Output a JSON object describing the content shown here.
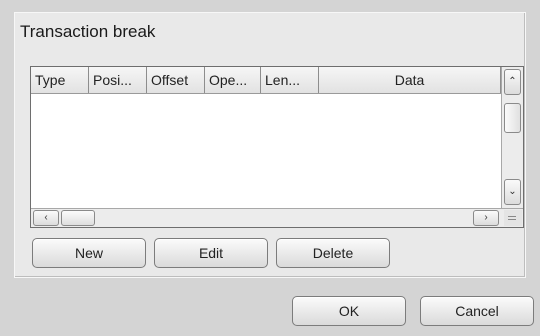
{
  "group": {
    "title": "Transaction break"
  },
  "table": {
    "columns": [
      {
        "label": "Type"
      },
      {
        "label": "Posi..."
      },
      {
        "label": "Offset"
      },
      {
        "label": "Ope..."
      },
      {
        "label": "Len..."
      },
      {
        "label": "Data"
      }
    ],
    "rows": []
  },
  "scrollbars": {
    "up_arrow": "⌃",
    "down_arrow": "⌄",
    "left_arrow": "‹",
    "right_arrow": "›"
  },
  "table_buttons": {
    "new": "New",
    "edit": "Edit",
    "delete": "Delete"
  },
  "dialog_buttons": {
    "ok": "OK",
    "cancel": "Cancel"
  }
}
